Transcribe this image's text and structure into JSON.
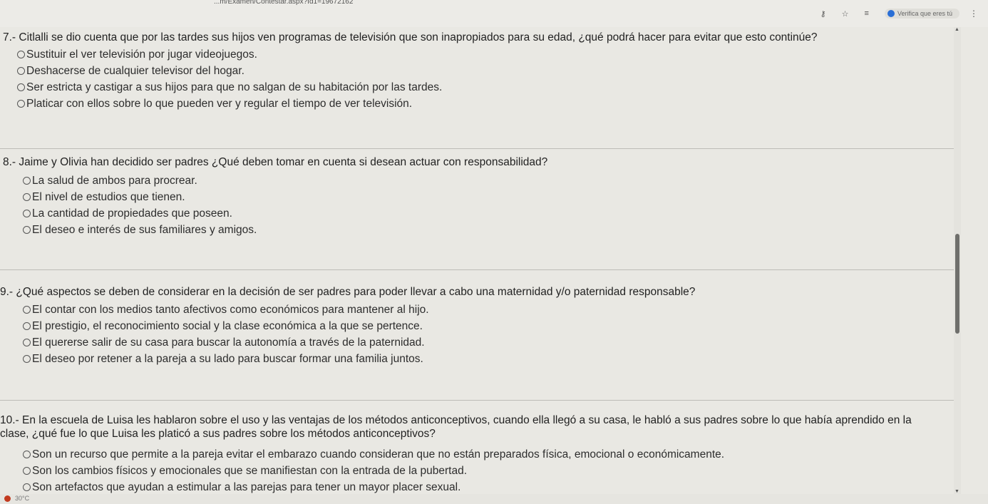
{
  "browser": {
    "url": "...m/Examen/Contestar.aspx?Id1=19672162",
    "verify_label": "Verifica que eres tú"
  },
  "questions": [
    {
      "text": "7.- Citlalli se dio cuenta que por las tardes sus hijos ven programas de televisión que son inapropiados para su edad, ¿qué podrá hacer para evitar que esto continúe?",
      "options": [
        "Sustituir el ver televisión por jugar videojuegos.",
        "Deshacerse de cualquier televisor del hogar.",
        "Ser estricta y castigar a sus hijos para que no salgan de su habitación por las tardes.",
        "Platicar con ellos sobre lo que pueden ver y regular el tiempo de ver televisión."
      ]
    },
    {
      "text": "8.- Jaime y Olivia han decidido ser padres ¿Qué deben tomar en cuenta si desean actuar con responsabilidad?",
      "options": [
        "La salud de ambos para procrear.",
        "El nivel de estudios que tienen.",
        "La cantidad de propiedades que poseen.",
        "El deseo e interés de sus familiares y amigos."
      ]
    },
    {
      "text": "9.- ¿Qué aspectos se deben de considerar en la decisión de ser padres para poder llevar a cabo una maternidad y/o paternidad responsable?",
      "options": [
        "El contar con los medios tanto afectivos como económicos para mantener al hijo.",
        "El prestigio, el reconocimiento social y la clase económica a la que se pertence.",
        "El quererse salir de su casa para buscar la autonomía a través de la paternidad.",
        "El deseo por retener a la pareja a su lado para buscar formar una familia juntos."
      ]
    },
    {
      "text": "10.- En la escuela de Luisa les hablaron sobre el uso y las ventajas de los métodos anticonceptivos, cuando ella llegó a su casa, le habló a sus padres sobre lo que había aprendido en la clase, ¿qué fue lo que Luisa les platicó a sus padres sobre los métodos anticonceptivos?",
      "options": [
        "Son un recurso que permite a la pareja evitar el embarazo cuando consideran que no están preparados física, emocional o económicamente.",
        "Son los cambios físicos y emocionales que se manifiestan con la entrada de la pubertad.",
        "Son artefactos que ayudan a estimular a las parejas para tener un mayor placer sexual."
      ]
    }
  ],
  "taskbar": {
    "temperature": "30°C"
  }
}
